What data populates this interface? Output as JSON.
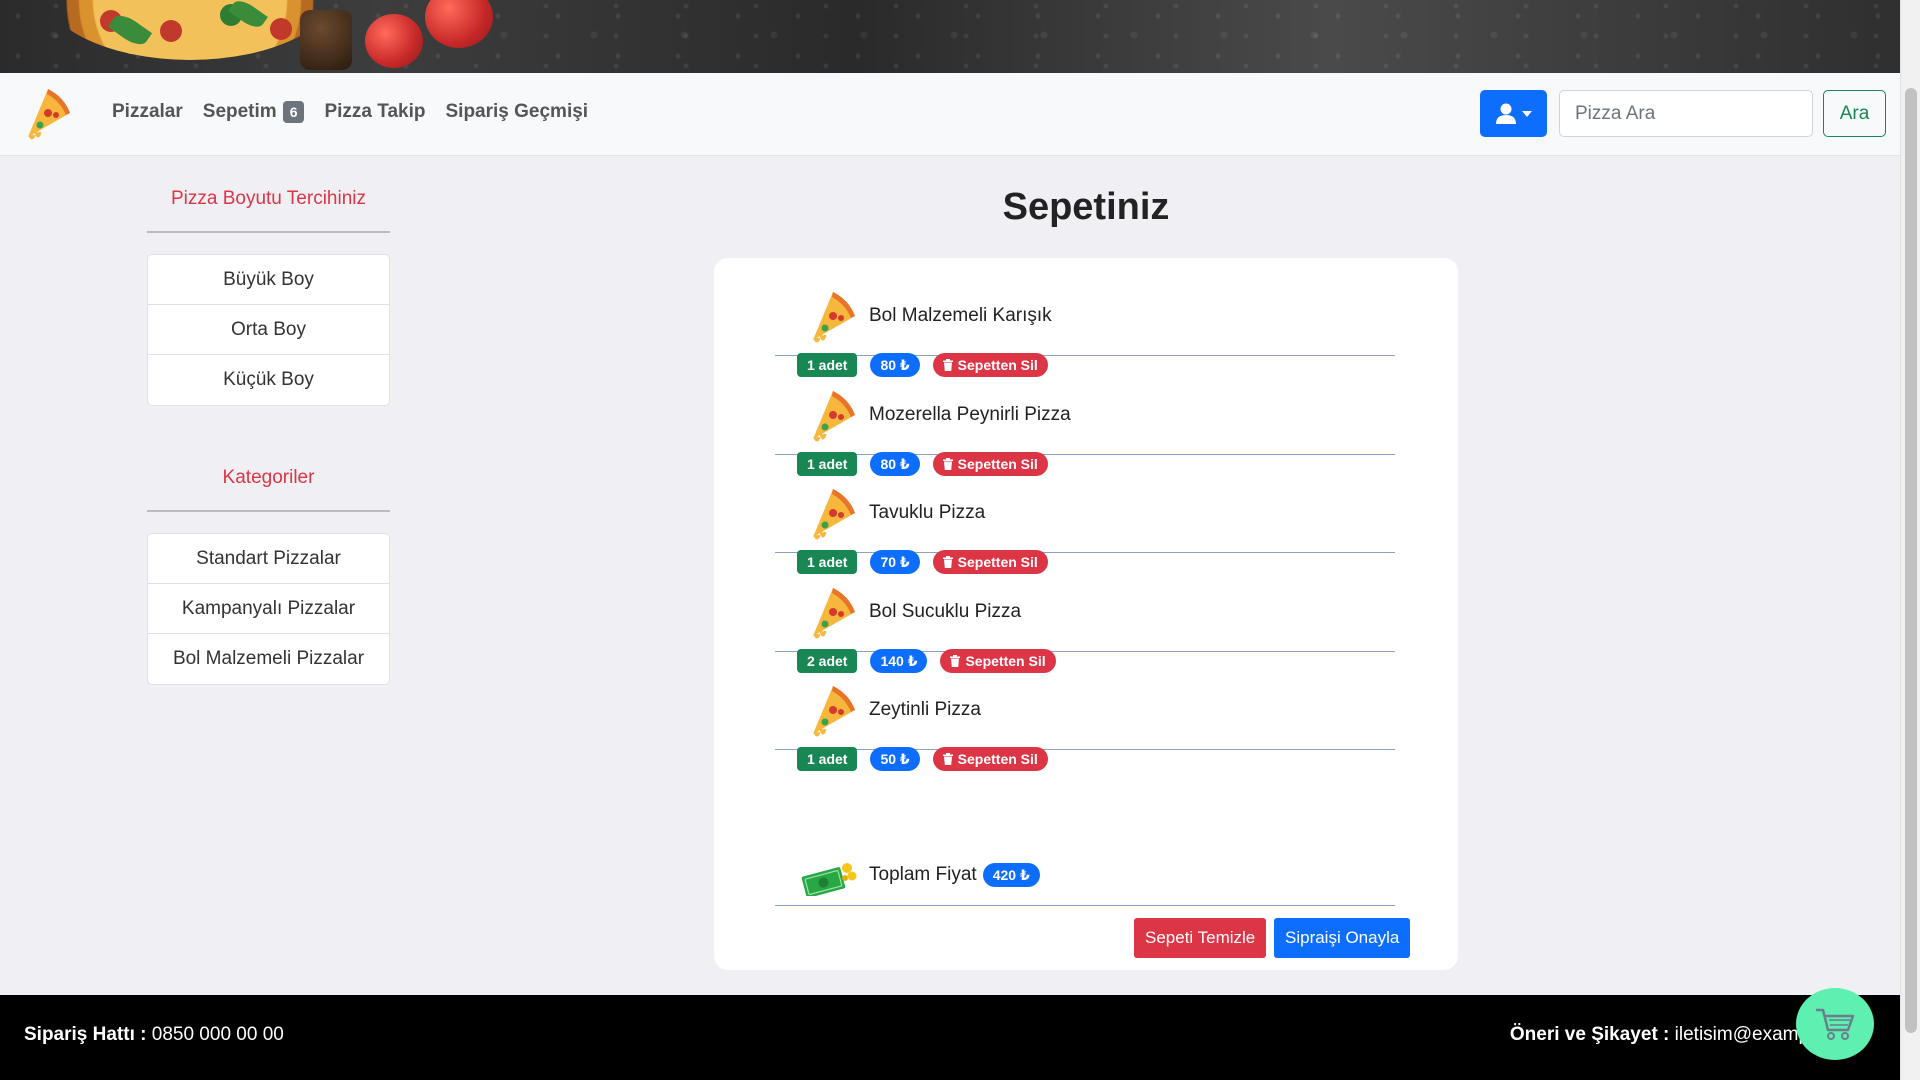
{
  "navbar": {
    "links": [
      {
        "label": "Pizzalar"
      },
      {
        "label": "Sepetim",
        "badge": "6"
      },
      {
        "label": "Pizza Takip"
      },
      {
        "label": "Sipariş Geçmişi"
      }
    ],
    "search_placeholder": "Pizza Ara",
    "search_button": "Ara"
  },
  "sidebar": {
    "size_title": "Pizza Boyutu Tercihiniz",
    "sizes": [
      "Büyük Boy",
      "Orta Boy",
      "Küçük Boy"
    ],
    "category_title": "Kategoriler",
    "categories": [
      "Standart Pizzalar",
      "Kampanyalı Pizzalar",
      "Bol Malzemeli Pizzalar"
    ]
  },
  "cart": {
    "title": "Sepetiniz",
    "delete_label": "Sepetten Sil",
    "items": [
      {
        "name": "Bol Malzemeli Karışık",
        "qty": "1 adet",
        "price": "80 ₺"
      },
      {
        "name": "Mozerella Peynirli Pizza",
        "qty": "1 adet",
        "price": "80 ₺"
      },
      {
        "name": "Tavuklu Pizza",
        "qty": "1 adet",
        "price": "70 ₺"
      },
      {
        "name": "Bol Sucuklu Pizza",
        "qty": "2 adet",
        "price": "140 ₺"
      },
      {
        "name": "Zeytinli Pizza",
        "qty": "1 adet",
        "price": "50 ₺"
      }
    ],
    "total_label": "Toplam Fiyat",
    "total_value": "420 ₺",
    "clear_button": "Sepeti Temizle",
    "confirm_button": "Sipraişi Onayla"
  },
  "footer": {
    "phone_label": "Sipariş Hattı :",
    "phone_value": "0850 000 00 00",
    "contact_label": "Öneri ve Şikayet :",
    "contact_value": "iletisim@example.com"
  },
  "colors": {
    "primary": "#0d6efd",
    "success": "#198754",
    "danger": "#dc3545",
    "fab": "#5ef0b0"
  },
  "icons": {
    "brand": "pizza-slice-icon",
    "user": "user-icon",
    "delete": "trash-icon",
    "total": "money-icon",
    "fab": "shopping-cart-icon"
  }
}
